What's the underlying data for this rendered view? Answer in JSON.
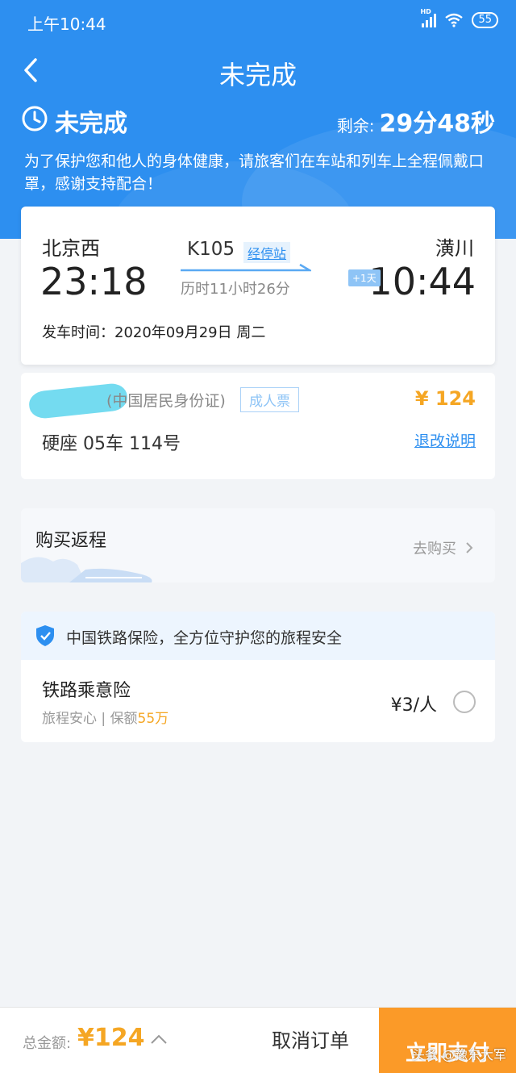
{
  "status_bar": {
    "time": "上午10:44",
    "signal_label": "HD",
    "battery": "55"
  },
  "nav": {
    "title": "未完成"
  },
  "order_status": {
    "state": "未完成",
    "remaining_label": "剩余:",
    "remaining_value": "29分48秒"
  },
  "notice": "为了保护您和他人的身体健康，请旅客们在车站和列车上全程佩戴口罩，感谢支持配合！",
  "trip": {
    "from_station": "北京西",
    "to_station": "潢川",
    "departure_time": "23:18",
    "arrival_time": "10:44",
    "train_number": "K105",
    "stops_link": "经停站",
    "duration": "历时11小时26分",
    "plus_day": "+1天",
    "departure_date": "发车时间：2020年09月29日 周二"
  },
  "passenger": {
    "id_type": "(中国居民身份证)",
    "ticket_type": "成人票",
    "price": "¥ 124",
    "seat": "硬座 05车 114号",
    "refund_link": "退改说明"
  },
  "return_trip": {
    "title": "购买返程",
    "action": "去购买"
  },
  "insurance": {
    "headline": "中国铁路保险，全方位守护您的旅程安全",
    "name": "铁路乘意险",
    "desc_prefix": "旅程安心 | 保额",
    "coverage": "55万",
    "price": "¥3/人",
    "selected": false
  },
  "footer": {
    "total_label": "总金额:",
    "total_value": "¥124",
    "cancel_label": "取消订单",
    "pay_label": "立即支付",
    "watermark": "头条 @豫东大军"
  },
  "colors": {
    "primary": "#2d8ff0",
    "accent": "#f5a623",
    "pay_button": "#fb9a28"
  }
}
